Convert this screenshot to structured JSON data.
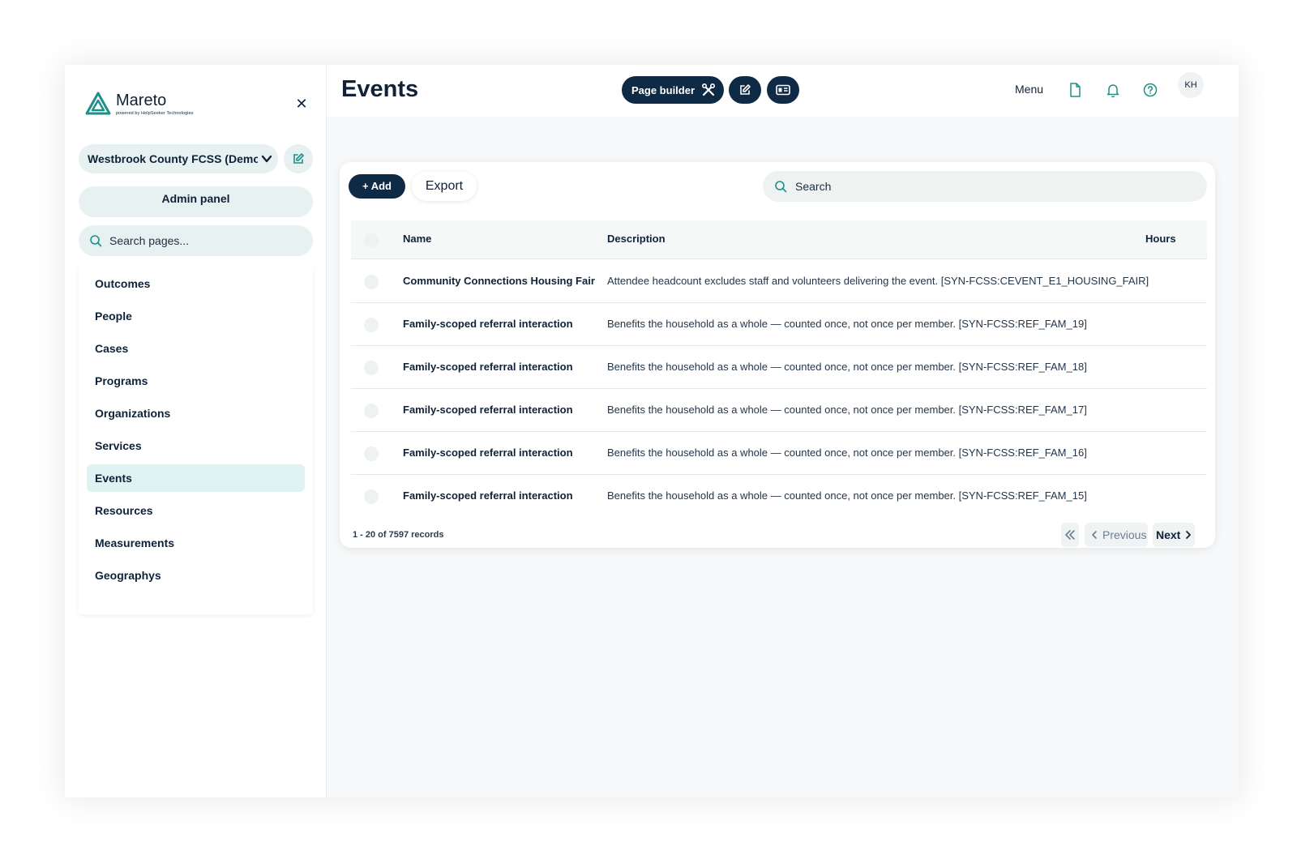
{
  "brand": {
    "name": "Mareto",
    "tagline": "powered by HelpSeeker Technologies"
  },
  "sidebar": {
    "org_name": "Westbrook County FCSS (Demor",
    "admin_label": "Admin panel",
    "search_placeholder": "Search pages...",
    "items": [
      {
        "label": "Outcomes"
      },
      {
        "label": "People"
      },
      {
        "label": "Cases"
      },
      {
        "label": "Programs"
      },
      {
        "label": "Organizations"
      },
      {
        "label": "Services"
      },
      {
        "label": "Events",
        "active": true
      },
      {
        "label": "Resources"
      },
      {
        "label": "Measurements"
      },
      {
        "label": "Geographys"
      }
    ]
  },
  "header": {
    "title": "Events",
    "page_builder_label": "Page builder",
    "menu_label": "Menu",
    "avatar_initials": "KH"
  },
  "toolbar": {
    "add_label": "+ Add",
    "export_label": "Export",
    "search_placeholder": "Search"
  },
  "table": {
    "columns": {
      "name": "Name",
      "description": "Description",
      "hours": "Hours"
    },
    "rows": [
      {
        "name": "Community Connections Housing Fair",
        "description": "Attendee headcount excludes staff and volunteers delivering the event. [SYN-FCSS:CEVENT_E1_HOUSING_FAIR]"
      },
      {
        "name": "Family-scoped referral interaction",
        "description": "Benefits the household as a whole — counted once, not once per member. [SYN-FCSS:REF_FAM_19]"
      },
      {
        "name": "Family-scoped referral interaction",
        "description": "Benefits the household as a whole — counted once, not once per member. [SYN-FCSS:REF_FAM_18]"
      },
      {
        "name": "Family-scoped referral interaction",
        "description": "Benefits the household as a whole — counted once, not once per member. [SYN-FCSS:REF_FAM_17]"
      },
      {
        "name": "Family-scoped referral interaction",
        "description": "Benefits the household as a whole — counted once, not once per member. [SYN-FCSS:REF_FAM_16]"
      },
      {
        "name": "Family-scoped referral interaction",
        "description": "Benefits the household as a whole — counted once, not once per member. [SYN-FCSS:REF_FAM_15]"
      }
    ]
  },
  "pagination": {
    "records_label": "1 - 20 of 7597 records",
    "previous_label": "Previous",
    "next_label": "Next"
  },
  "colors": {
    "primary": "#0f2a44",
    "accent": "#1f8f8a",
    "active_bg": "#e0f3f3",
    "pill_bg": "#e8f1f1"
  }
}
